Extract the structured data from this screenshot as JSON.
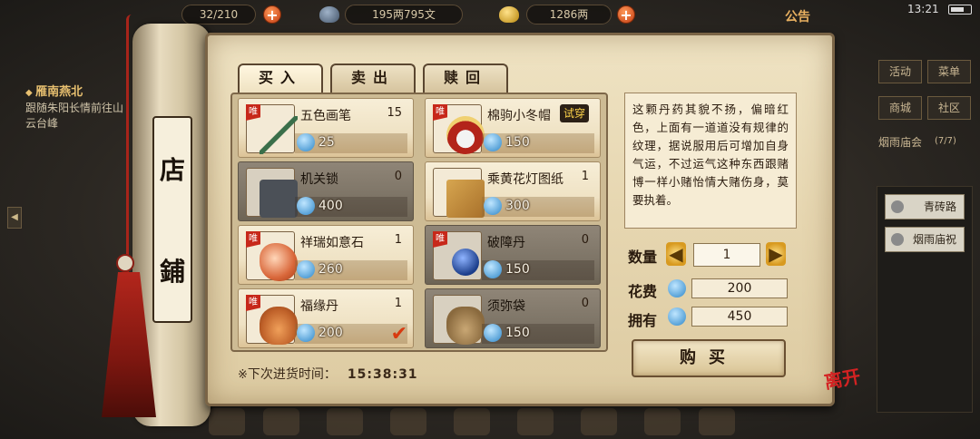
{
  "topbar": {
    "bag_partial": "32/210",
    "money": "195两795文",
    "ingots": "1286两",
    "notice": "公告",
    "time": "13:21"
  },
  "quest": {
    "title": "雁南燕北",
    "desc": "跟随朱阳长情前往山云台峰"
  },
  "side_menu": {
    "btn1": "活动",
    "btn2": "菜单",
    "btn3": "商城",
    "btn4": "社区",
    "event": "烟雨庙会",
    "event_count": "(7/7)",
    "task1": "青砖路",
    "task2": "烟雨庙祝"
  },
  "shop": {
    "title_top": "店",
    "title_bottom": "鋪",
    "tabs": [
      "买入",
      "卖出",
      "赎回"
    ],
    "tag": "唯",
    "items": [
      {
        "name": "五色画笔",
        "count": "15",
        "price": "25",
        "art": "brush"
      },
      {
        "name": "棉驹小冬帽",
        "badge": "试穿",
        "price": "150",
        "art": "hat"
      },
      {
        "name": "机关锁",
        "count": "0",
        "price": "400",
        "art": "lock"
      },
      {
        "name": "乘黄花灯图纸",
        "count": "1",
        "price": "300",
        "art": "paper"
      },
      {
        "name": "祥瑞如意石",
        "count": "1",
        "price": "260",
        "art": "stone"
      },
      {
        "name": "破障丹",
        "count": "0",
        "price": "150",
        "art": "pill"
      },
      {
        "name": "福缘丹",
        "count": "1",
        "price": "200",
        "art": "bag"
      },
      {
        "name": "须弥袋",
        "count": "0",
        "price": "150",
        "art": "pouch"
      }
    ],
    "refresh_symbol": "※",
    "refresh_label": "下次进货时间：",
    "refresh_time": "15:38:31"
  },
  "detail": {
    "description": "这颗丹药其貌不扬，偏暗红色，上面有一道道没有规律的纹理，据说服用后可增加自身气运，不过运气这种东西跟赌博一样小赌怡情大赌伤身，莫要执着。",
    "qty_label": "数量",
    "qty_value": "1",
    "cost_label": "花费",
    "cost_value": "200",
    "owned_label": "拥有",
    "owned_value": "450",
    "buy_label": "购买",
    "close_label": "离开"
  }
}
